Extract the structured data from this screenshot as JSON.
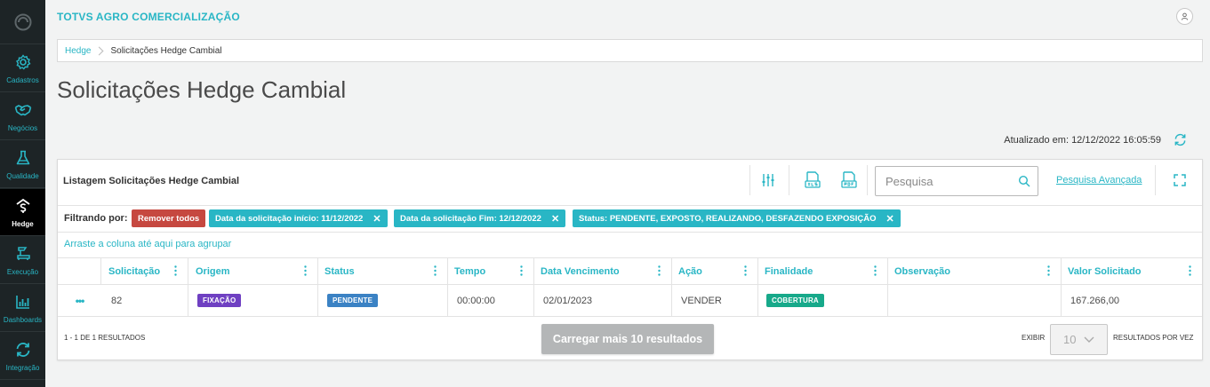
{
  "app": {
    "company": "TOTVS AGRO COMERCIALIZAÇÃO"
  },
  "sidebar": {
    "items": [
      {
        "label": "Cadastros",
        "icon": "gear-icon"
      },
      {
        "label": "Negócios",
        "icon": "handshake-icon"
      },
      {
        "label": "Qualidade",
        "icon": "flask-icon"
      },
      {
        "label": "Hedge",
        "icon": "hedge-icon",
        "active": true
      },
      {
        "label": "Execução",
        "icon": "execution-icon"
      },
      {
        "label": "Dashboards",
        "icon": "bar-chart-icon"
      },
      {
        "label": "Integração",
        "icon": "sync-icon"
      }
    ]
  },
  "breadcrumb": {
    "root": "Hedge",
    "current": "Solicitações Hedge Cambial"
  },
  "page": {
    "title": "Solicitações Hedge Cambial",
    "updated": "Atualizado em: 12/12/2022 16:05:59"
  },
  "card": {
    "title": "Listagem Solicitações Hedge Cambial",
    "search_placeholder": "Pesquisa",
    "advanced_search": "Pesquisa Avançada",
    "filter_label": "Filtrando por:",
    "remove_all": "Remover todos",
    "filters": [
      "Data da solicitação início: 11/12/2022",
      "Data da solicitação Fim: 12/12/2022",
      "Status: PENDENTE, EXPOSTO, REALIZANDO, DESFAZENDO EXPOSIÇÃO"
    ],
    "group_hint": "Arraste a coluna até aqui para agrupar"
  },
  "table": {
    "columns": [
      "Solicitação",
      "Origem",
      "Status",
      "Tempo",
      "Data Vencimento",
      "Ação",
      "Finalidade",
      "Observação",
      "Valor Solicitado"
    ],
    "rows": [
      {
        "actions": "•••",
        "solicitacao": "82",
        "origem": "FIXAÇÃO",
        "status": "PENDENTE",
        "tempo": "00:00:00",
        "vencimento": "02/01/2023",
        "acao": "VENDER",
        "finalidade": "COBERTURA",
        "observacao": "",
        "valor": "167.266,00"
      }
    ]
  },
  "footer": {
    "count": "1 - 1 DE 1 RESULTADOS",
    "load_more": "Carregar mais 10 resultados",
    "show_label": "EXIBIR",
    "page_size": "10",
    "per_page_label": "RESULTADOS POR VEZ"
  },
  "colors": {
    "accent": "#29b6c5",
    "sidebar_bg": "#1d2426",
    "danger": "#c64840",
    "tag_purple": "#6f40c2",
    "tag_blue": "#3b82c4",
    "tag_green": "#17a98a"
  }
}
